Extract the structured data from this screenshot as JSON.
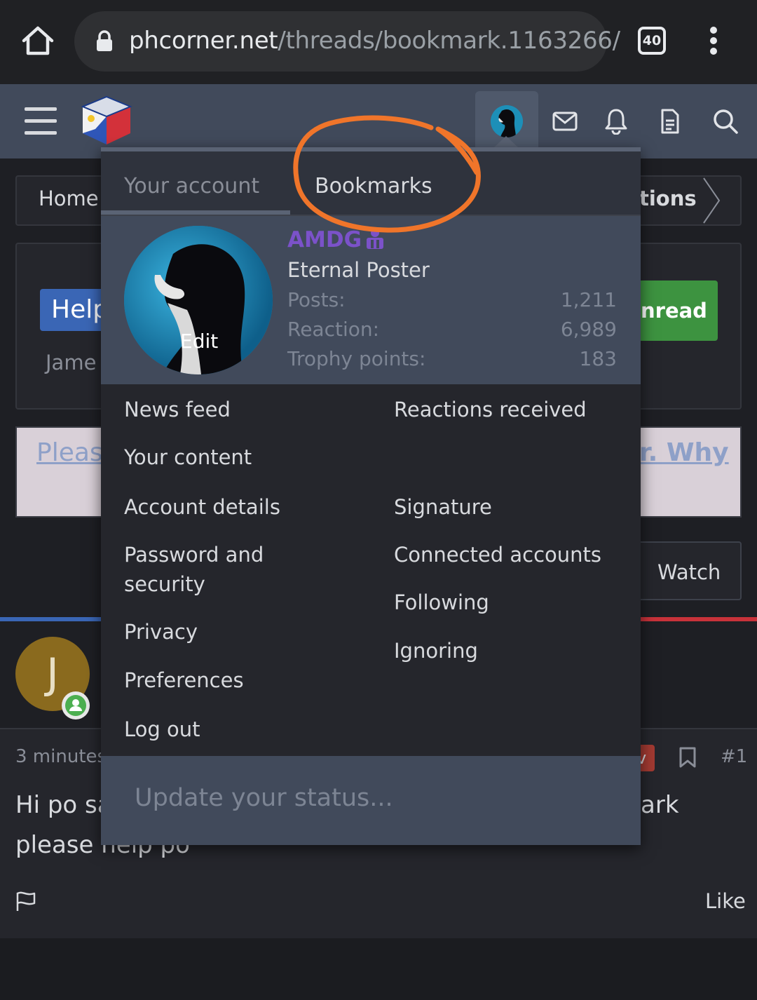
{
  "browser": {
    "url_domain": "phcorner.net",
    "url_path": "/threads/bookmark.1163266/",
    "tab_count": "40"
  },
  "page": {
    "breadcrumb_home": "Home",
    "breadcrumb_right": "tions",
    "thread_prefix": "Help",
    "thread_author": "Jame",
    "unread_button": "nread",
    "notice_left": "Pleas",
    "notice_right": "r. Why",
    "watch_button": "Watch",
    "post_avatar_letter": "J",
    "post_time": "3 minutes",
    "post_badge": "v",
    "post_number": "#1",
    "post_line1_left": "Hi po sa",
    "post_line1_right": "ark",
    "post_line2": "please help po",
    "like_button": "Like"
  },
  "menu": {
    "tab_account": "Your account",
    "tab_bookmarks": "Bookmarks",
    "username": "AMDG",
    "user_title": "Eternal Poster",
    "avatar_edit": "Edit",
    "stats": [
      {
        "label": "Posts:",
        "value": "1,211"
      },
      {
        "label": "Reaction:",
        "value": "6,989"
      },
      {
        "label": "Trophy points:",
        "value": "183"
      }
    ],
    "left_links": [
      "News feed",
      "Your content",
      "Account details",
      "Password and security",
      "Privacy",
      "Preferences",
      "Log out"
    ],
    "right_links": [
      "Reactions received",
      "Signature",
      "Connected accounts",
      "Following",
      "Ignoring"
    ],
    "status_placeholder": "Update your status..."
  },
  "colors": {
    "accent_purple": "#7b52c9",
    "annotation_orange": "#f0752a",
    "online_green": "#4caf50",
    "button_green": "#3d9340",
    "prefix_blue": "#3a66b5"
  },
  "icons": [
    "home-icon",
    "lock-icon",
    "tab-count-icon",
    "kebab-menu-icon",
    "hamburger-icon",
    "site-logo",
    "mail-icon",
    "bell-icon",
    "document-icon",
    "search-icon",
    "bookmark-icon",
    "flag-icon"
  ]
}
